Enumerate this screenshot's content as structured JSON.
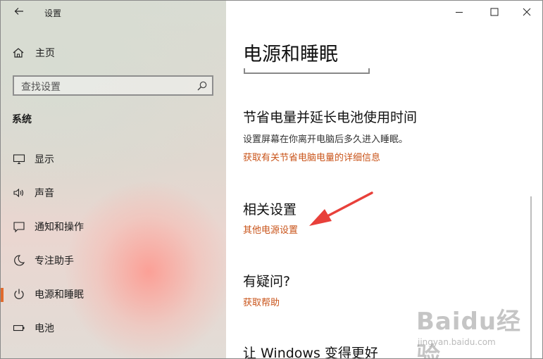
{
  "window": {
    "title": "设置",
    "back_icon": "back-arrow-icon",
    "controls": [
      "minimize-icon",
      "maximize-icon",
      "close-icon"
    ]
  },
  "sidebar": {
    "home_label": "主页",
    "search_placeholder": "查找设置",
    "section_title": "系统",
    "items": [
      {
        "label": "显示",
        "icon": "monitor-icon"
      },
      {
        "label": "声音",
        "icon": "speaker-icon"
      },
      {
        "label": "通知和操作",
        "icon": "notification-icon"
      },
      {
        "label": "专注助手",
        "icon": "moon-icon"
      },
      {
        "label": "电源和睡眠",
        "icon": "power-icon",
        "active": true
      },
      {
        "label": "电池",
        "icon": "battery-icon"
      }
    ]
  },
  "main": {
    "page_title": "电源和睡眠",
    "save_power": {
      "heading": "节省电量并延长电池使用时间",
      "description": "设置屏幕在你离开电脑后多久进入睡眠。",
      "link": "获取有关节省电脑电量的详细信息"
    },
    "related": {
      "heading": "相关设置",
      "link": "其他电源设置"
    },
    "question": {
      "heading": "有疑问?",
      "link": "获取帮助"
    },
    "improve": {
      "heading": "让 Windows 变得更好"
    }
  },
  "watermark": {
    "brand": "Baidu经验",
    "url": "jingyan.baidu.com"
  },
  "colors": {
    "accent": "#e06b2e",
    "link": "#c9541a",
    "annotation_arrow": "#e8403a"
  }
}
